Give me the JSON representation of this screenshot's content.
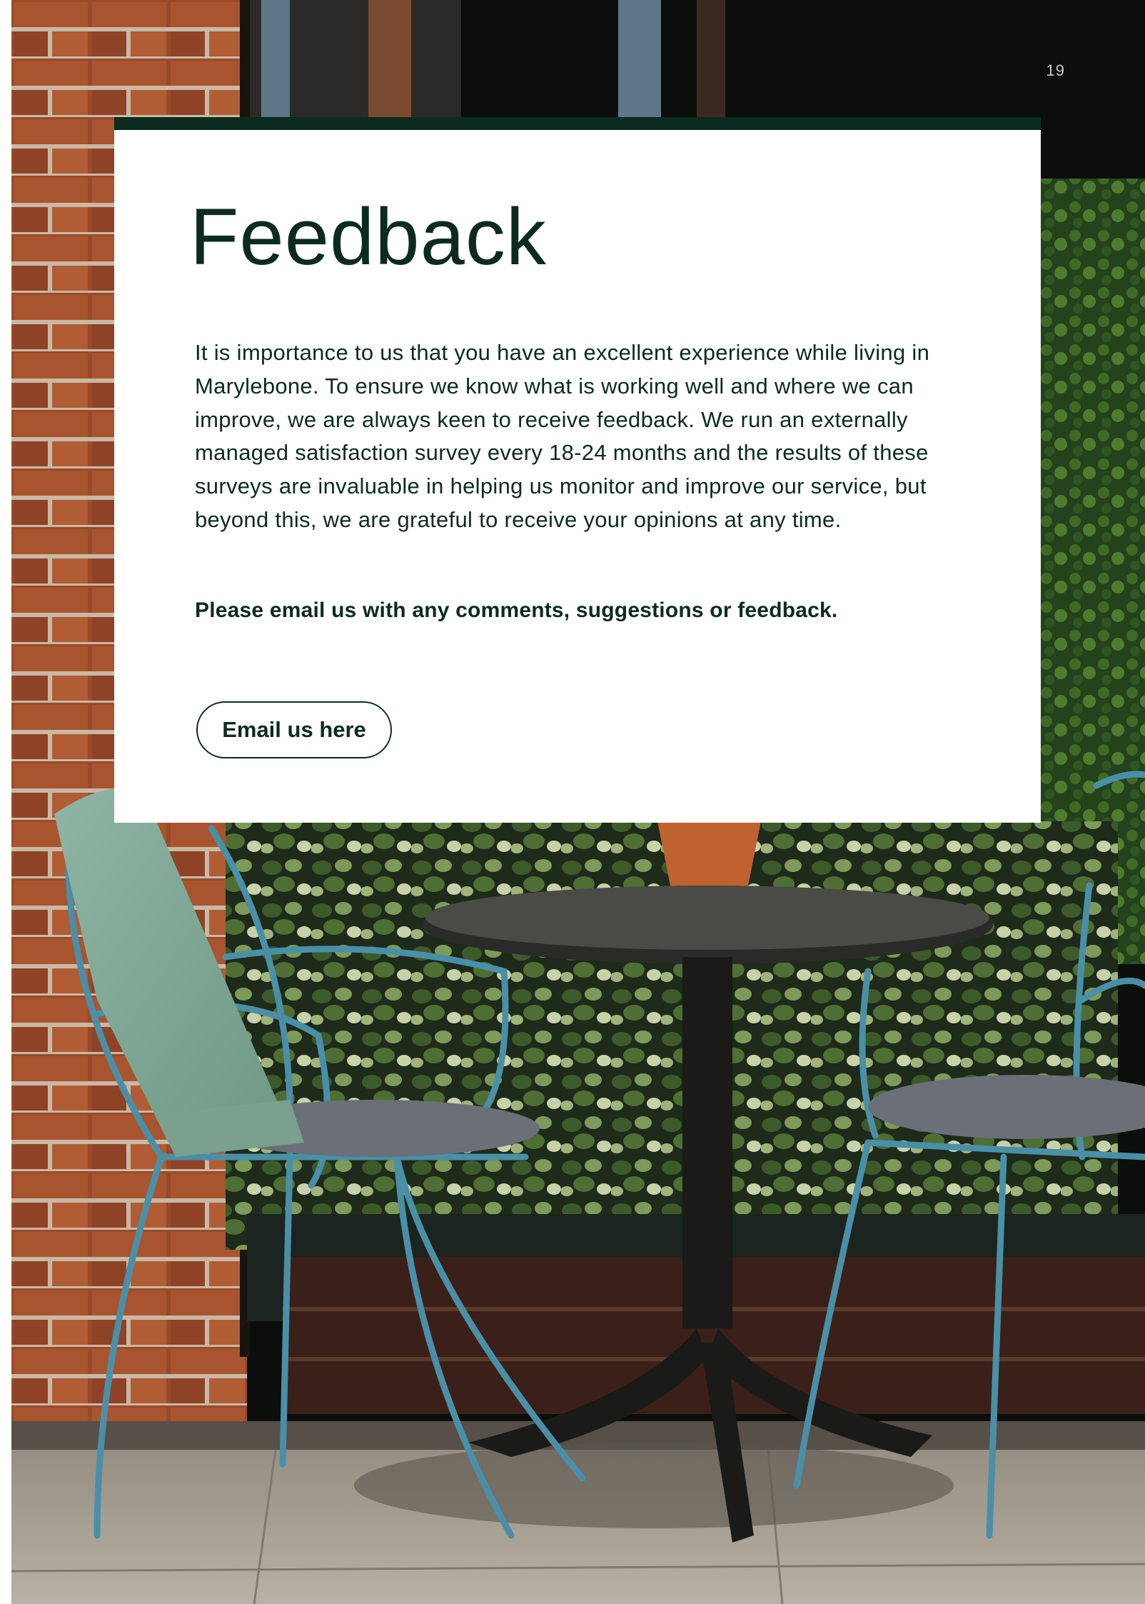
{
  "page": {
    "number": "19"
  },
  "feedback": {
    "title": "Feedback",
    "body": "It is importance to us that you have an excellent experience while living in Marylebone. To ensure we know what is working well and where we can improve, we are always keen to receive feedback. We run an externally managed satisfaction survey every 18-24 months and the results of these surveys are invaluable in helping us monitor and improve our service, but beyond this, we are grateful to receive your opinions at any time.",
    "cta_text": "Please email us with any comments, suggestions or feedback.",
    "button_label": "Email us here"
  },
  "colors": {
    "brand_dark_green": "#0c2b20",
    "card_background": "#ffffff",
    "page_number": "#c9c9c9"
  },
  "background_photo": {
    "subject": "outdoor cafe table with two teal metal chairs, brick wall and ivy"
  }
}
